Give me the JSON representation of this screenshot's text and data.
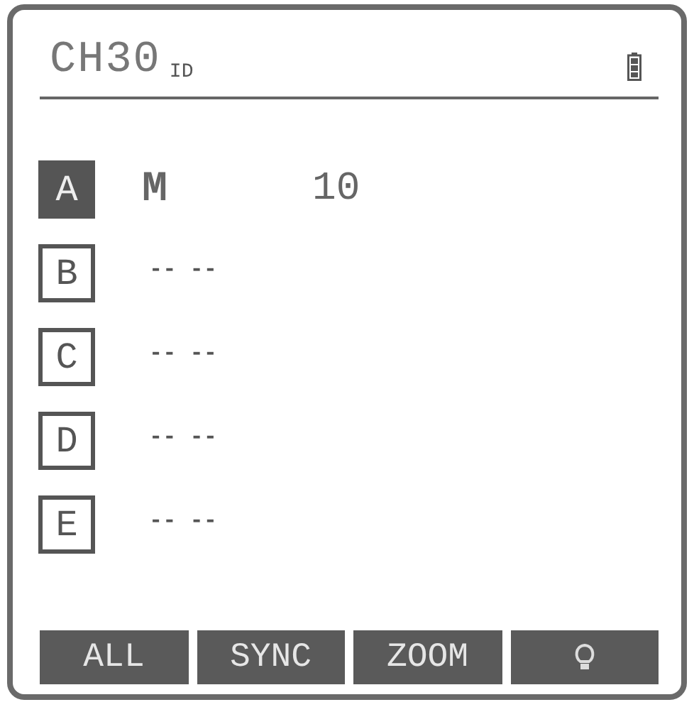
{
  "header": {
    "channel": "CH30",
    "suffix": "ID"
  },
  "channels": [
    {
      "letter": "A",
      "selected": true,
      "kind": "set",
      "mode": "M",
      "value": "10"
    },
    {
      "letter": "B",
      "selected": false,
      "kind": "empty",
      "mode": "-- --"
    },
    {
      "letter": "C",
      "selected": false,
      "kind": "empty",
      "mode": "-- --"
    },
    {
      "letter": "D",
      "selected": false,
      "kind": "empty",
      "mode": "-- --"
    },
    {
      "letter": "E",
      "selected": false,
      "kind": "empty",
      "mode": "-- --"
    }
  ],
  "buttons": [
    {
      "kind": "text",
      "label": "ALL"
    },
    {
      "kind": "text",
      "label": "SYNC"
    },
    {
      "kind": "text",
      "label": "ZOOM"
    },
    {
      "kind": "bulb"
    }
  ]
}
